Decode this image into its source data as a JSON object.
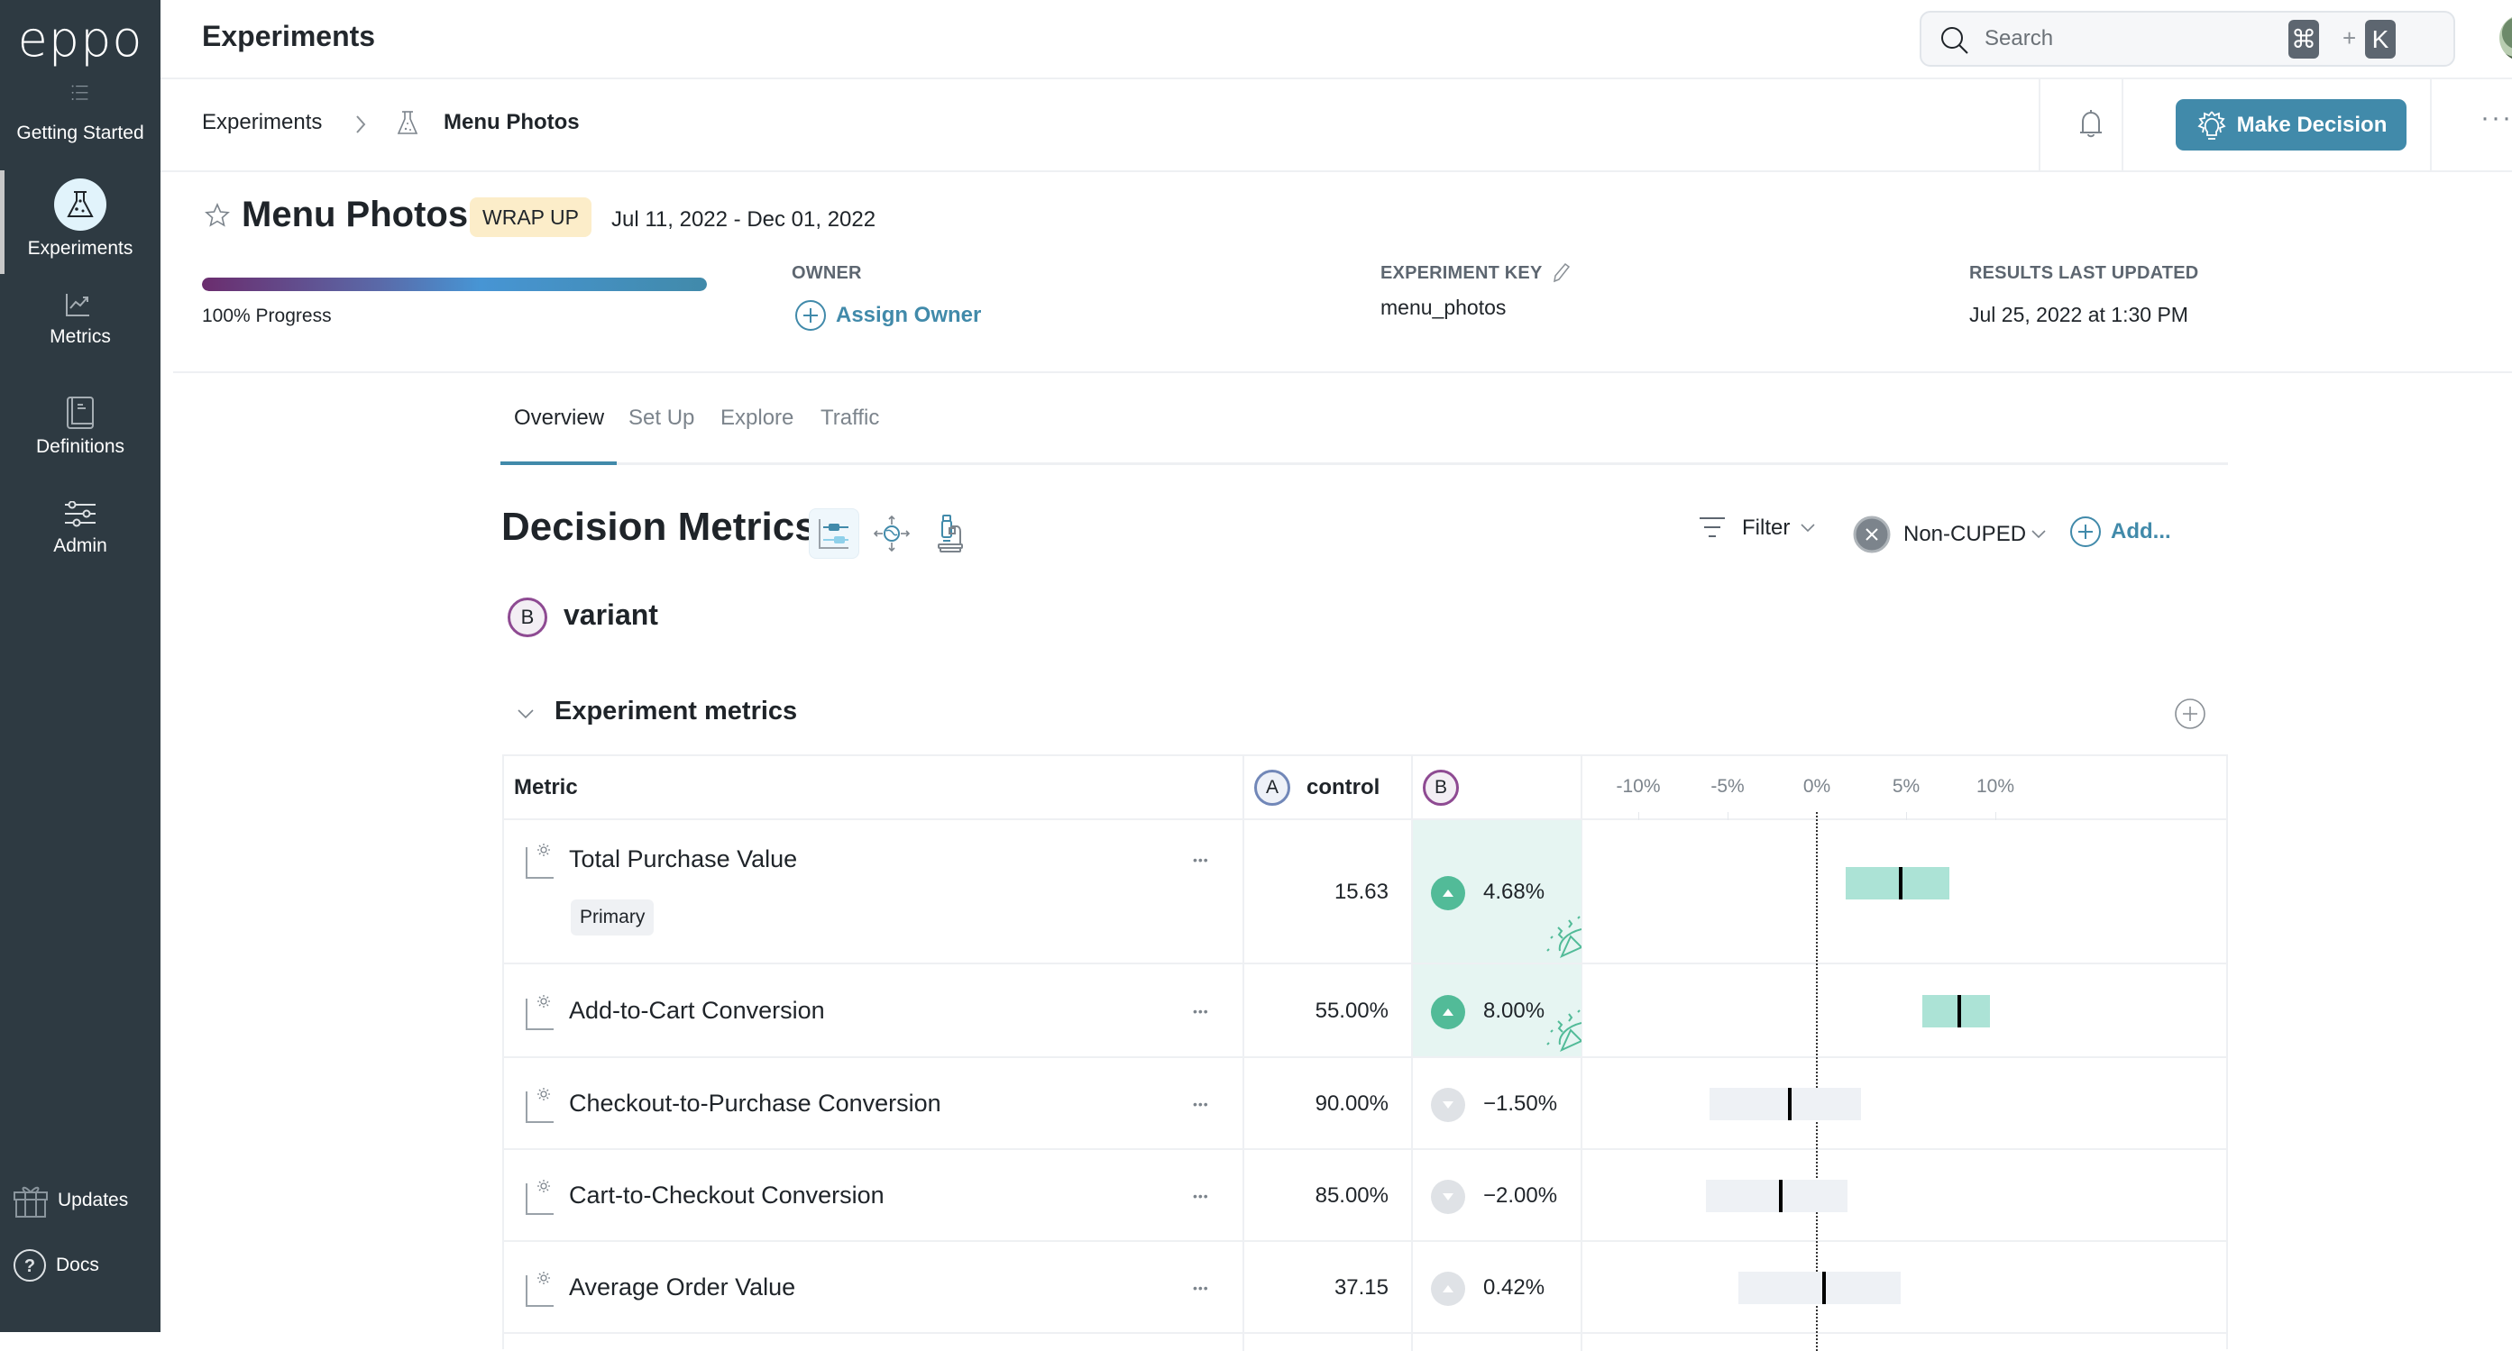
{
  "sidebar": {
    "logo": "eppo",
    "items": [
      {
        "label": "Getting Started",
        "icon": "list-icon",
        "active": false
      },
      {
        "label": "Experiments",
        "icon": "flask-icon",
        "active": true
      },
      {
        "label": "Metrics",
        "icon": "chart-line-icon",
        "active": false
      },
      {
        "label": "Definitions",
        "icon": "book-icon",
        "active": false
      },
      {
        "label": "Admin",
        "icon": "sliders-icon",
        "active": false
      }
    ],
    "bottom": [
      {
        "label": "Updates",
        "icon": "gift-icon"
      },
      {
        "label": "Docs",
        "icon": "help-circle-icon"
      }
    ]
  },
  "header": {
    "title": "Experiments",
    "search": {
      "placeholder": "Search",
      "shortcut_mod": "⌘",
      "shortcut_plus": "+",
      "shortcut_key": "K"
    }
  },
  "breadcrumb": {
    "root": "Experiments",
    "current": "Menu Photos",
    "make_decision": "Make Decision",
    "more": "···"
  },
  "experiment": {
    "name": "Menu Photos",
    "status": "WRAP UP",
    "date_range": "Jul 11, 2022 - Dec 01, 2022",
    "progress_percent": 100,
    "progress_label": "100% Progress",
    "owner_label": "OWNER",
    "assign_owner": "Assign Owner",
    "key_label": "EXPERIMENT KEY",
    "key_value": "menu_photos",
    "updated_label": "RESULTS LAST UPDATED",
    "updated_value": "Jul 25, 2022 at 1:30 PM"
  },
  "tabs": [
    {
      "label": "Overview",
      "active": true
    },
    {
      "label": "Set Up",
      "active": false
    },
    {
      "label": "Explore",
      "active": false
    },
    {
      "label": "Traffic",
      "active": false
    }
  ],
  "decision_metrics": {
    "title": "Decision Metrics",
    "filter": "Filter",
    "cuped": "Non-CUPED",
    "add": "Add...",
    "variant_letter": "B",
    "variant_name": "variant",
    "section_title": "Experiment metrics"
  },
  "table": {
    "metric_header": "Metric",
    "control_letter": "A",
    "control_name": "control",
    "variant_letter": "B",
    "axis": {
      "min": -12,
      "max": 12,
      "ticks": [
        -10,
        -5,
        0,
        5,
        10
      ],
      "tick_labels": [
        "-10%",
        "-5%",
        "0%",
        "5%",
        "10%"
      ]
    },
    "colors": {
      "positive_fill": "#ace3d6",
      "neutral_fill": "#eef1f5",
      "positive_dot": "#52bb98",
      "neutral_dot": "#dfe2e6"
    },
    "rows": [
      {
        "name": "Total Purchase Value",
        "tag": "Primary",
        "control": "15.63",
        "lift": "4.68%",
        "lift_value": 4.68,
        "ci_low": 1.6,
        "ci_high": 7.4,
        "direction": "up",
        "significant": true
      },
      {
        "name": "Add-to-Cart Conversion",
        "tag": null,
        "control": "55.00%",
        "lift": "8.00%",
        "lift_value": 8.0,
        "ci_low": 5.9,
        "ci_high": 9.7,
        "direction": "up",
        "significant": true
      },
      {
        "name": "Checkout-to-Purchase Conversion",
        "tag": null,
        "control": "90.00%",
        "lift": "−1.50%",
        "lift_value": -1.5,
        "ci_low": -6.0,
        "ci_high": 2.5,
        "direction": "down",
        "significant": false
      },
      {
        "name": "Cart-to-Checkout Conversion",
        "tag": null,
        "control": "85.00%",
        "lift": "−2.00%",
        "lift_value": -2.0,
        "ci_low": -6.2,
        "ci_high": 1.7,
        "direction": "down",
        "significant": false
      },
      {
        "name": "Average Order Value",
        "tag": null,
        "control": "37.15",
        "lift": "0.42%",
        "lift_value": 0.42,
        "ci_low": -4.4,
        "ci_high": 4.7,
        "direction": "up",
        "significant": false
      }
    ]
  }
}
